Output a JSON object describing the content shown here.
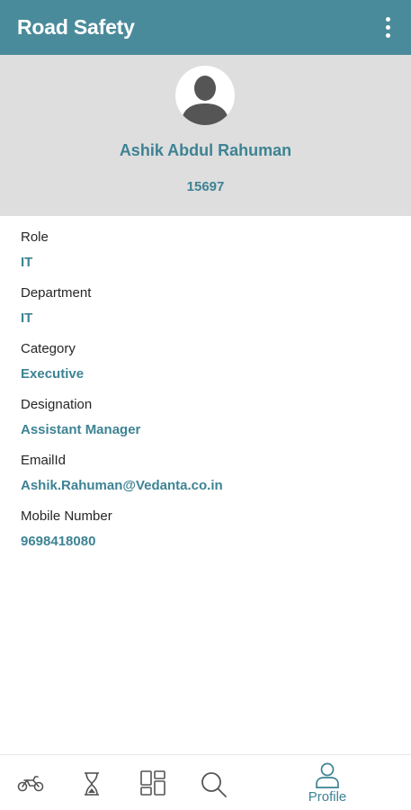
{
  "app_bar": {
    "title": "Road Safety",
    "menu_icon": "more-vert-icon"
  },
  "profile": {
    "avatar_icon": "person-avatar-icon",
    "name": "Ashik Abdul Rahuman",
    "employee_id": "15697"
  },
  "details": [
    {
      "label": "Role",
      "value": "IT"
    },
    {
      "label": "Department",
      "value": "IT"
    },
    {
      "label": "Category",
      "value": "Executive"
    },
    {
      "label": "Designation",
      "value": "Assistant Manager"
    },
    {
      "label": "EmailId",
      "value": "Ashik.Rahuman@Vedanta.co.in"
    },
    {
      "label": "Mobile Number",
      "value": "9698418080"
    }
  ],
  "bottom_nav": {
    "items": [
      {
        "icon": "motorbike-icon"
      },
      {
        "icon": "hourglass-icon"
      },
      {
        "icon": "dashboard-grid-icon"
      },
      {
        "icon": "search-icon"
      },
      {
        "icon": "profile-icon",
        "label": "Profile",
        "active": true
      }
    ]
  },
  "colors": {
    "app_bar": "#4a8b9b",
    "accent": "#3d8393",
    "header_bg": "#dedede",
    "icon_gray": "#555555"
  }
}
